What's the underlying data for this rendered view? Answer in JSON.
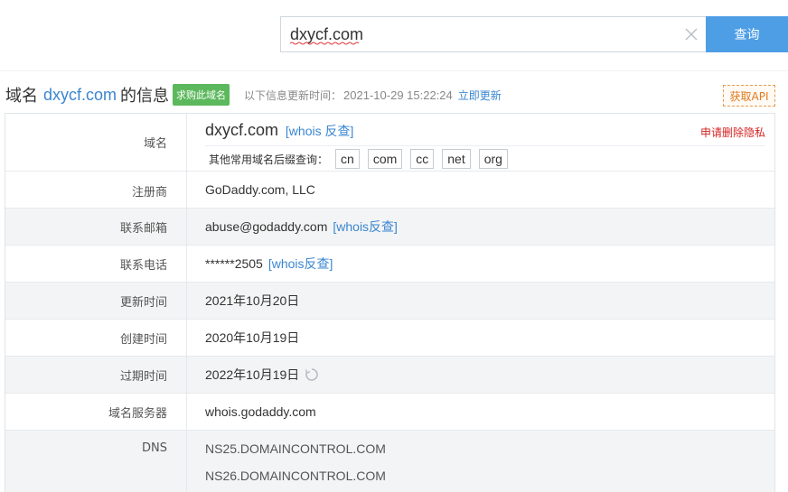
{
  "search": {
    "value": "dxycf.com",
    "button_label": "查询"
  },
  "header": {
    "title_prefix": "域名",
    "domain": "dxycf.com",
    "title_suffix": "的信息",
    "buy_badge": "求购此域名",
    "update_label": "以下信息更新时间：",
    "update_time": "2021-10-29 15:22:24",
    "update_link": "立即更新",
    "api_button": "获取API"
  },
  "table": {
    "domain": {
      "label": "域名",
      "value": "dxycf.com",
      "whois_link": "[whois 反查]",
      "privacy_link": "申请删除隐私",
      "suffix_label": "其他常用域名后缀查询：",
      "suffixes": [
        "cn",
        "com",
        "cc",
        "net",
        "org"
      ]
    },
    "registrar": {
      "label": "注册商",
      "value": "GoDaddy.com, LLC"
    },
    "email": {
      "label": "联系邮箱",
      "value": "abuse@godaddy.com",
      "link": "[whois反查]"
    },
    "phone": {
      "label": "联系电话",
      "value": "******2505",
      "link": "[whois反查]"
    },
    "updated": {
      "label": "更新时间",
      "value": "2021年10月20日"
    },
    "created": {
      "label": "创建时间",
      "value": "2020年10月19日"
    },
    "expires": {
      "label": "过期时间",
      "value": "2022年10月19日"
    },
    "whois_server": {
      "label": "域名服务器",
      "value": "whois.godaddy.com"
    },
    "dns": {
      "label": "DNS",
      "servers": [
        "NS25.DOMAINCONTROL.COM",
        "NS26.DOMAINCONTROL.COM"
      ]
    }
  },
  "colors": {
    "accent": "#4e9ee6",
    "link": "#3a86d0",
    "badge": "#5cb85c",
    "privacy": "#d62222",
    "api": "#e07a1e"
  },
  "icons": {
    "clear": "close-icon",
    "refresh": "refresh-icon"
  }
}
